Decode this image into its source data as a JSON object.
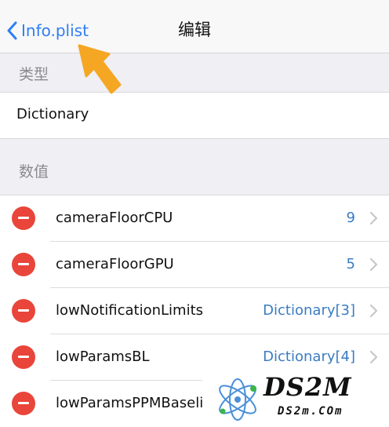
{
  "nav": {
    "back_label": "Info.plist",
    "title": "编辑"
  },
  "type_section": {
    "header": "类型",
    "value": "Dictionary"
  },
  "value_section": {
    "header": "数值",
    "items": [
      {
        "key": "cameraFloorCPU",
        "value": "9"
      },
      {
        "key": "cameraFloorGPU",
        "value": "5"
      },
      {
        "key": "lowNotificationLimits",
        "value": "Dictionary[3]"
      },
      {
        "key": "lowParamsBL",
        "value": "Dictionary[4]"
      },
      {
        "key": "lowParamsPPMBaseli",
        "value": ""
      }
    ]
  },
  "annotation": {
    "arrow_color": "#f5a623"
  },
  "watermark": {
    "brand": "DS2M",
    "domain": "DS2m.COm"
  },
  "colors": {
    "accent": "#2f7ef5",
    "delete": "#e9453a",
    "value_text": "#3a7cc2"
  }
}
